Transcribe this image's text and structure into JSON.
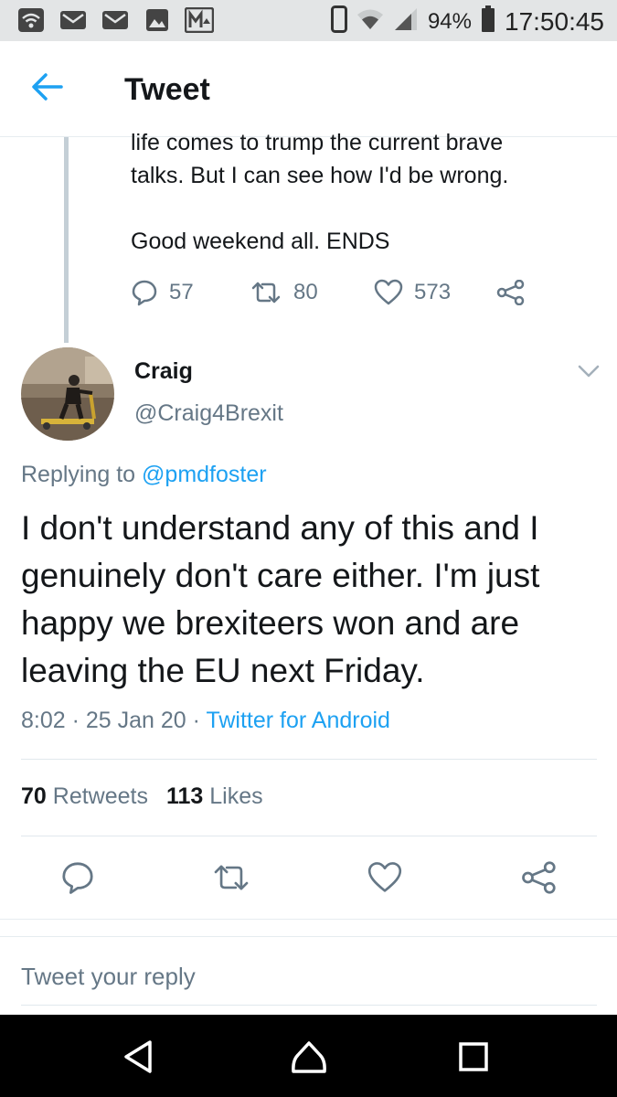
{
  "status_bar": {
    "battery": "94%",
    "time": "17:50:45",
    "icons": [
      "wifi-hotspot-icon",
      "mail-icon",
      "mail-icon",
      "image-icon",
      "gallery-icon",
      "phone-icon",
      "wifi-icon",
      "signal-icon",
      "battery-icon"
    ]
  },
  "header": {
    "title": "Tweet"
  },
  "previous_tweet": {
    "lines": [
      "life comes to trump the current brave",
      "talks. But I can see how I'd be wrong."
    ],
    "closing": "Good weekend all. ENDS",
    "replies": "57",
    "retweets": "80",
    "likes": "573"
  },
  "tweet": {
    "name": "Craig",
    "handle": "@Craig4Brexit",
    "replying_prefix": "Replying to ",
    "replying_to": "@pmdfoster",
    "text": "I don't understand any of this and I genuinely don't care either. I'm just happy we brexiteers won and are leaving the EU next Friday.",
    "time": "8:02",
    "date": "25 Jan 20",
    "source": "Twitter for Android",
    "retweet_count": "70",
    "retweet_label": "Retweets",
    "like_count": "113",
    "like_label": "Likes"
  },
  "reply": {
    "placeholder": "Tweet your reply"
  },
  "colors": {
    "accent": "#1da1f2",
    "secondary": "#657786",
    "text": "#14171a"
  }
}
